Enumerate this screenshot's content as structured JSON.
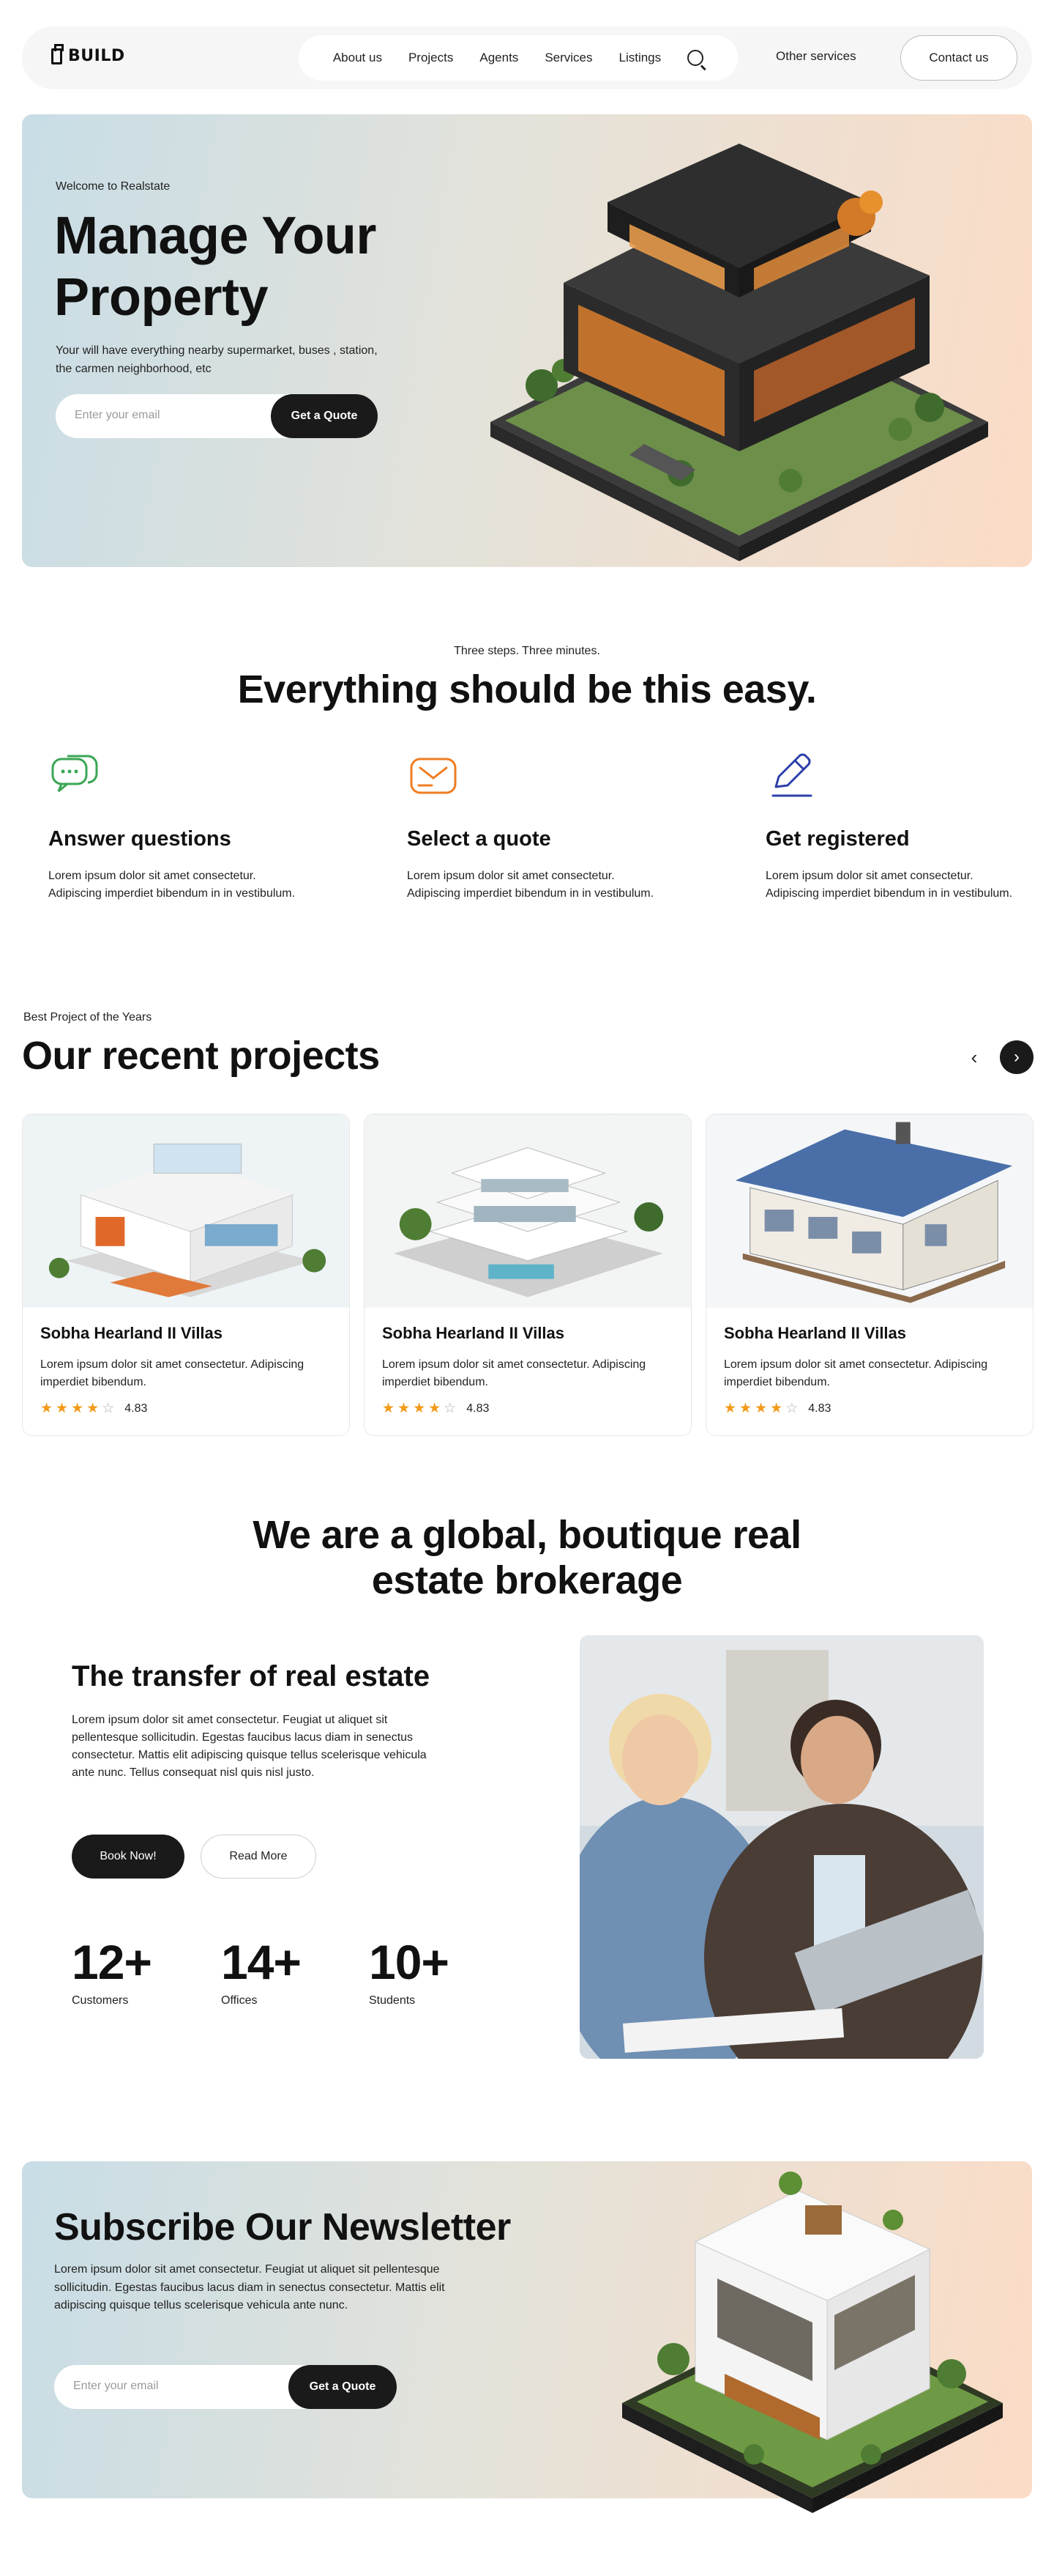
{
  "nav": {
    "logo": "BUILD",
    "links": [
      "About us",
      "Projects",
      "Agents",
      "Services",
      "Listings"
    ],
    "other": "Other services",
    "contact": "Contact us"
  },
  "hero": {
    "kicker": "Welcome to Realstate",
    "title": "Manage Your Property",
    "description": "Your will have everything nearby supermarket, buses , station, the carmen neighborhood, etc",
    "email_placeholder": "Enter your email",
    "cta": "Get a Quote"
  },
  "steps": {
    "kicker": "Three steps. Three minutes.",
    "title": "Everything should be this easy.",
    "items": [
      {
        "title": "Answer questions",
        "desc": "Lorem ipsum dolor sit amet consectetur. Adipiscing imperdiet bibendum in in vestibulum.",
        "icon": "chat-bubbles-icon",
        "color": "#3aa655"
      },
      {
        "title": "Select a quote",
        "desc": "Lorem ipsum dolor sit amet consectetur. Adipiscing imperdiet bibendum in in vestibulum.",
        "icon": "mail-icon",
        "color": "#ef7d22"
      },
      {
        "title": "Get registered",
        "desc": "Lorem ipsum dolor sit amet consectetur. Adipiscing imperdiet bibendum in in vestibulum.",
        "icon": "pen-icon",
        "color": "#2c3fa8"
      }
    ]
  },
  "projects": {
    "kicker": "Best Project of the Years",
    "title": "Our recent projects",
    "cards": [
      {
        "title": "Sobha Hearland II Villas",
        "desc": "Lorem ipsum dolor sit amet consectetur. Adipiscing imperdiet bibendum.",
        "rating": "4.83",
        "stars": 4
      },
      {
        "title": "Sobha Hearland II Villas",
        "desc": "Lorem ipsum dolor sit amet consectetur. Adipiscing imperdiet bibendum.",
        "rating": "4.83",
        "stars": 4
      },
      {
        "title": "Sobha Hearland II Villas",
        "desc": "Lorem ipsum dolor sit amet consectetur. Adipiscing imperdiet bibendum.",
        "rating": "4.83",
        "stars": 4
      }
    ]
  },
  "about": {
    "title": "We are a global, boutique real estate brokerage",
    "subtitle": "The transfer of real estate",
    "description": "Lorem ipsum dolor sit amet consectetur. Feugiat ut aliquet sit pellentesque sollicitudin. Egestas faucibus lacus diam in senectus consectetur. Mattis elit adipiscing quisque tellus scelerisque vehicula ante nunc. Tellus consequat nisl quis nisl justo.",
    "btn_primary": "Book Now!",
    "btn_secondary": "Read More",
    "stats": [
      {
        "num": "12+",
        "label": "Customers"
      },
      {
        "num": "14+",
        "label": "Offices"
      },
      {
        "num": "10+",
        "label": "Students"
      }
    ]
  },
  "newsletter": {
    "title": "Subscribe Our Newsletter",
    "description": "Lorem ipsum dolor sit amet consectetur. Feugiat ut aliquet sit pellentesque sollicitudin. Egestas faucibus lacus diam in senectus consectetur. Mattis elit adipiscing quisque tellus scelerisque vehicula ante nunc.",
    "email_placeholder": "Enter your email",
    "cta": "Get a Quote"
  }
}
